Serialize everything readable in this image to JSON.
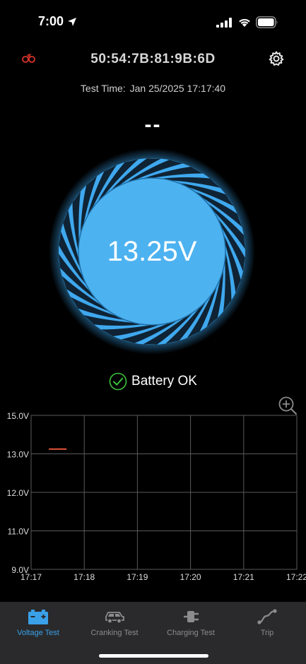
{
  "status_bar": {
    "time": "7:00"
  },
  "header": {
    "device_id": "50:54:7B:81:9B:6D"
  },
  "test_time": {
    "label": "Test Time:",
    "value": "Jan 25/2025 17:17:40"
  },
  "dash_text": "--",
  "gauge": {
    "value": "13.25V"
  },
  "battery_status": "Battery OK",
  "colors": {
    "accent": "#3aa0e8",
    "gauge_fill": "#4db2f0",
    "ok_green": "#3cc43c",
    "series_line": "#e8543a"
  },
  "chart_data": {
    "type": "line",
    "title": "",
    "xlabel": "",
    "ylabel": "",
    "y_ticks": [
      "15.0V",
      "13.0V",
      "12.0V",
      "11.0V",
      "9.0V"
    ],
    "y_tick_values": [
      15.0,
      13.0,
      12.0,
      11.0,
      9.0
    ],
    "x_ticks": [
      "17:17",
      "17:18",
      "17:19",
      "17:20",
      "17:21",
      "17:22"
    ],
    "grid": true,
    "series": [
      {
        "points": [
          {
            "x": "17:17:20",
            "y": 13.25
          },
          {
            "x": "17:17:40",
            "y": 13.25
          }
        ]
      }
    ]
  },
  "tabs": [
    {
      "label": "Voltage Test",
      "icon": "battery-icon",
      "active": true
    },
    {
      "label": "Cranking Test",
      "icon": "car-icon",
      "active": false
    },
    {
      "label": "Charging Test",
      "icon": "plug-icon",
      "active": false
    },
    {
      "label": "Trip",
      "icon": "route-icon",
      "active": false
    }
  ]
}
